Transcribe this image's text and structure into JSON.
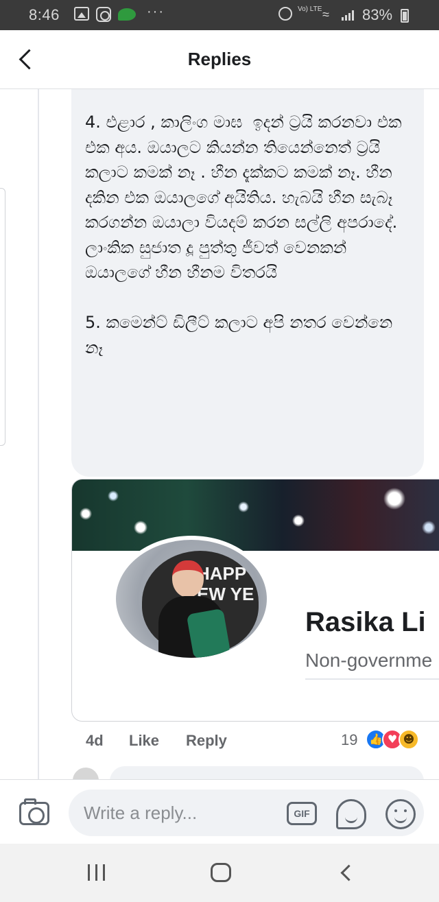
{
  "status_bar": {
    "time": "8:46",
    "overflow": "···",
    "network": "Vo) LTE",
    "battery": "83%",
    "icons": [
      "gallery-icon",
      "instagram-icon",
      "chat-icon",
      "alarm-icon",
      "wifi-icon",
      "signal-icon",
      "battery-icon"
    ]
  },
  "header": {
    "title": "Replies",
    "back_icon": "chevron-left-icon"
  },
  "comment": {
    "text": "4. එළාර , කාලිංග මාඝ  ඉදන් ට්‍රයි කරනවා එක එක අය. ඔයාලට කියන්න තියෙන්නෙත් ට්‍රයි කලාට කමක් නෑ . හීන දැක්කට කමක් නෑ. හීන දකින එක ඔයාලගේ අයිතිය. හැබයි හීන සැබෑ කරගන්න ඔයාලා වියදම් කරන සල්ලි අපරාදේ. ලාංකික සුජාත දූ පුත්තු ජීවත් වෙනකන් ඔයාලගේ හීන හීනම විතරයි\n\n5. කමෙන්ට් ඩිලීට් කලාට අපි නතර වෙන්නෙ නෑ",
    "card": {
      "page_name": "Rasika Li",
      "category": "Non-governme",
      "avatar_text": "HAPP\nEW YE"
    },
    "meta": {
      "time": "4d",
      "like_label": "Like",
      "reply_label": "Reply",
      "reaction_count": "19",
      "reactions": [
        "like-reaction-icon",
        "love-reaction-icon",
        "haha-reaction-icon"
      ]
    }
  },
  "composer": {
    "placeholder": "Write a reply...",
    "gif_label": "GIF",
    "icons": [
      "camera-icon",
      "gif-icon",
      "sticker-icon",
      "emoji-icon"
    ]
  },
  "colors": {
    "accent": "#1877f2",
    "bubble": "#f0f2f5",
    "secondary_text": "#65676b",
    "love": "#f33e58",
    "haha": "#f7b928"
  }
}
